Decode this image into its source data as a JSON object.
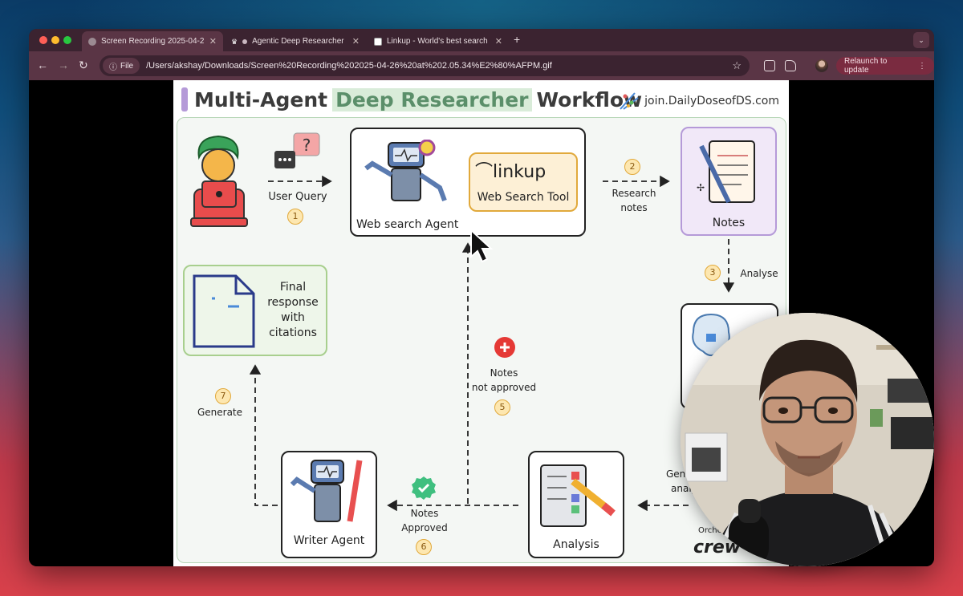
{
  "browser": {
    "tabs": [
      {
        "label": "Screen Recording 2025-04-2",
        "active": true
      },
      {
        "label": "Agentic Deep Researcher",
        "active": false
      },
      {
        "label": "Linkup - World's best search",
        "active": false
      }
    ],
    "url_chip": "File",
    "url": "/Users/akshay/Downloads/Screen%20Recording%202025-04-26%20at%202.05.34%E2%80%AFPM.gif",
    "relaunch_label": "Relaunch to update"
  },
  "diagram": {
    "title_pre": "Multi-Agent",
    "title_highlight": "Deep Researcher",
    "title_post": "Workflow",
    "brand": "join.DailyDoseofDS.com",
    "user_query": "User Query",
    "web_agent": "Web search Agent",
    "linkup_logo": "linkup",
    "web_tool": "Web Search Tool",
    "research_notes_1": "Research",
    "research_notes_2": "notes",
    "notes": "Notes",
    "analyse": "Analyse",
    "final_1": "Final",
    "final_2": "response",
    "final_3": "with",
    "final_4": "citations",
    "not_approved_1": "Notes",
    "not_approved_2": "not approved",
    "generate": "Generate",
    "approved_1": "Notes",
    "approved_2": "Approved",
    "writer": "Writer Agent",
    "analysis": "Analysis",
    "gen_partial_1": "Gen",
    "gen_partial_2": "analy",
    "orch_partial": "Orche",
    "crew_partial": "crew",
    "steps": [
      "1",
      "2",
      "3",
      "5",
      "6",
      "7"
    ]
  },
  "colors": {
    "highlight_bg": "#d9ecd9",
    "panel_border": "#b9d7b9",
    "badge_bg": "#fde7b0",
    "notes_box": "#b59ad8",
    "final_box": "#a8cf8e",
    "tool_box": "#e1a93b",
    "error": "#e53935",
    "ok": "#3fbf7f"
  }
}
